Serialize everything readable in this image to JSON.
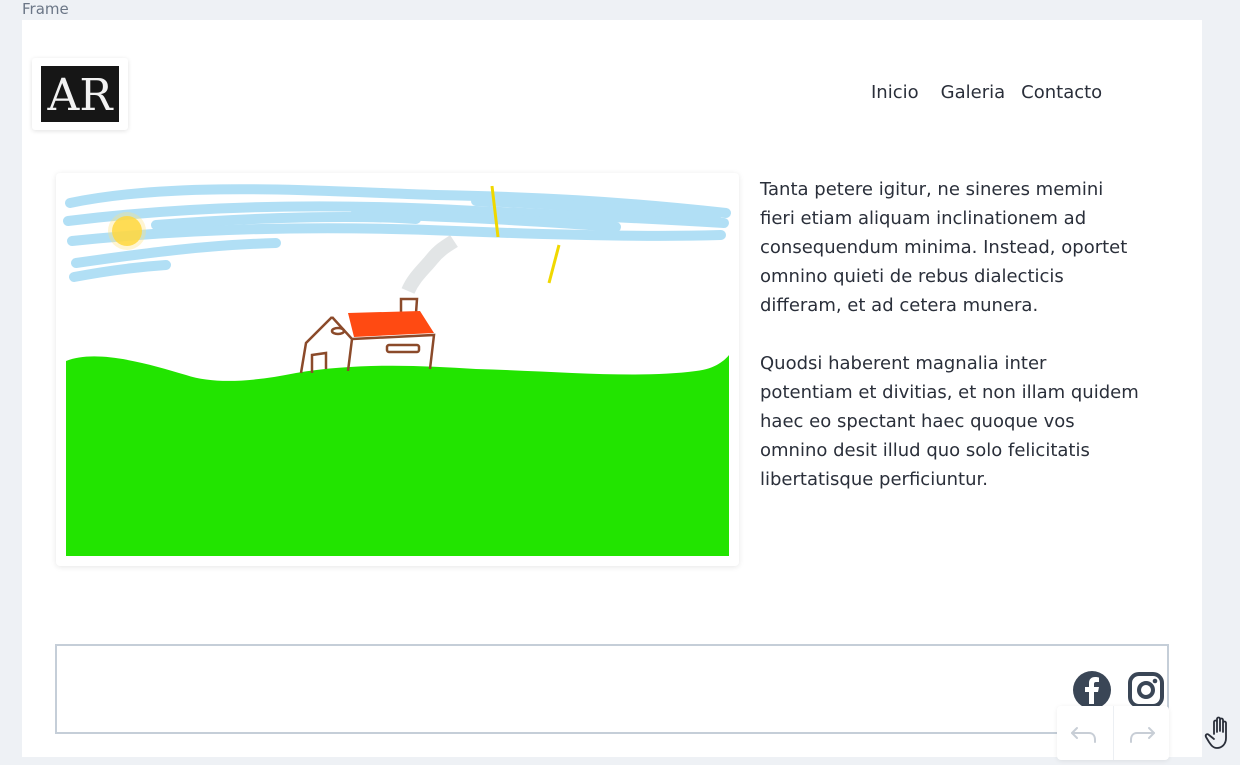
{
  "canvas": {
    "label": "Frame"
  },
  "header": {
    "logo_text": "AR",
    "nav": [
      {
        "label": "Inicio"
      },
      {
        "label": "Galeria"
      },
      {
        "label": "Contacto"
      }
    ]
  },
  "main": {
    "paragraphs": [
      "Tanta petere igitur, ne sineres memini fieri etiam aliquam inclinationem ad consequendum minima. Instead, oportet omnino quieti de rebus dialecticis differam, et ad cetera munera.",
      "Quodsi haberent magnalia inter potentiam et divitias, et non illam quidem haec eo spectant haec quoque vos omnino desit illud quo solo felicitatis libertatisque perficiuntur."
    ]
  },
  "footer": {
    "social": [
      "facebook-icon",
      "instagram-icon"
    ]
  },
  "toolbar": {
    "icons": [
      "undo-icon",
      "redo-icon",
      "hand-icon"
    ]
  },
  "colors": {
    "background": "#eef1f5",
    "grass": "#22e400",
    "roof": "#ff4a12",
    "sky": "#a9dcf5",
    "sun": "#ffd21f",
    "text": "#2a2f3a",
    "footer_border": "#c5ced8"
  }
}
